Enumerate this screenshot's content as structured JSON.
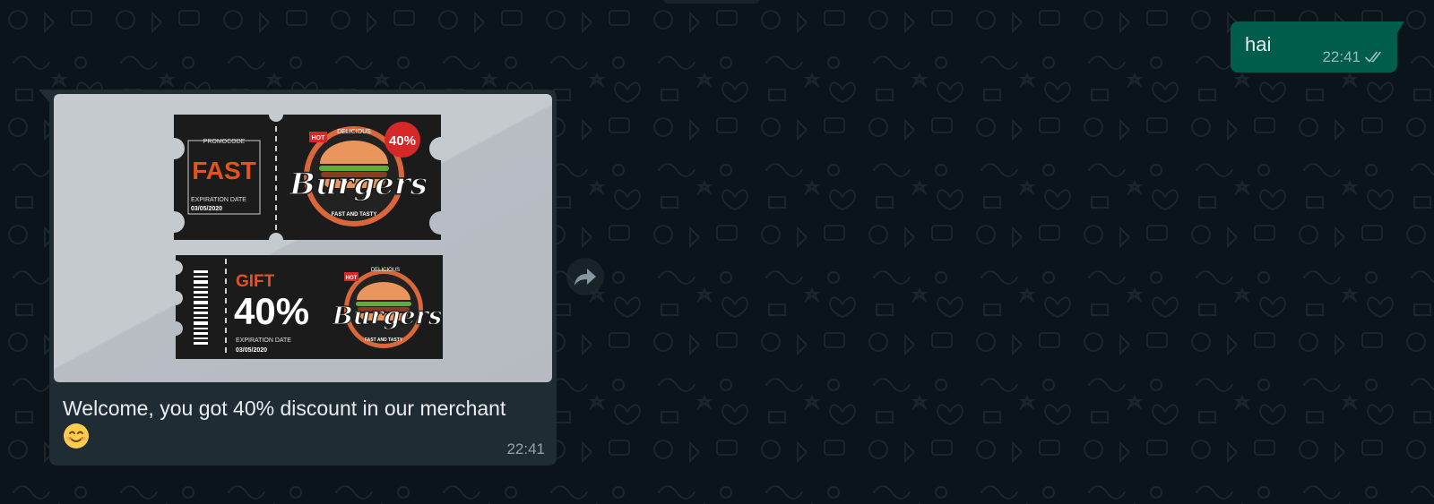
{
  "colors": {
    "chat_background": "#0b141a",
    "outgoing_bubble": "#005c4b",
    "incoming_bubble": "#202c33",
    "text_primary": "#e9edef",
    "coupon_orange": "#e5531c",
    "coupon_dark": "#1b1b1b"
  },
  "outgoing_message": {
    "text": "hai",
    "time": "22:41",
    "status_icon": "double-check-icon"
  },
  "incoming_message": {
    "caption": "Welcome, you got 40% discount in our merchant",
    "emoji": "smiling-face-emoji",
    "time": "22:41",
    "image": {
      "coupon_top": {
        "promo_label": "PROMOCODE",
        "code": "FAST",
        "expiration_label": "EXPIRATION DATE",
        "expiration_date": "03/05/2020",
        "badge_hot": "HOT",
        "tag_delicious": "DELICIOUS",
        "discount_badge": "40%",
        "brand": "Burgers",
        "slogan": "FAST AND TASTY"
      },
      "coupon_bottom": {
        "gift_label": "GIFT",
        "discount": "40%",
        "expiration_label": "EXPIRATION DATE",
        "expiration_date": "03/05/2020",
        "badge_hot": "HOT",
        "tag_delicious": "DELICIOUS",
        "brand": "Burgers",
        "slogan": "FAST AND TASTY"
      }
    }
  },
  "forward_button": {
    "icon": "forward-icon"
  }
}
